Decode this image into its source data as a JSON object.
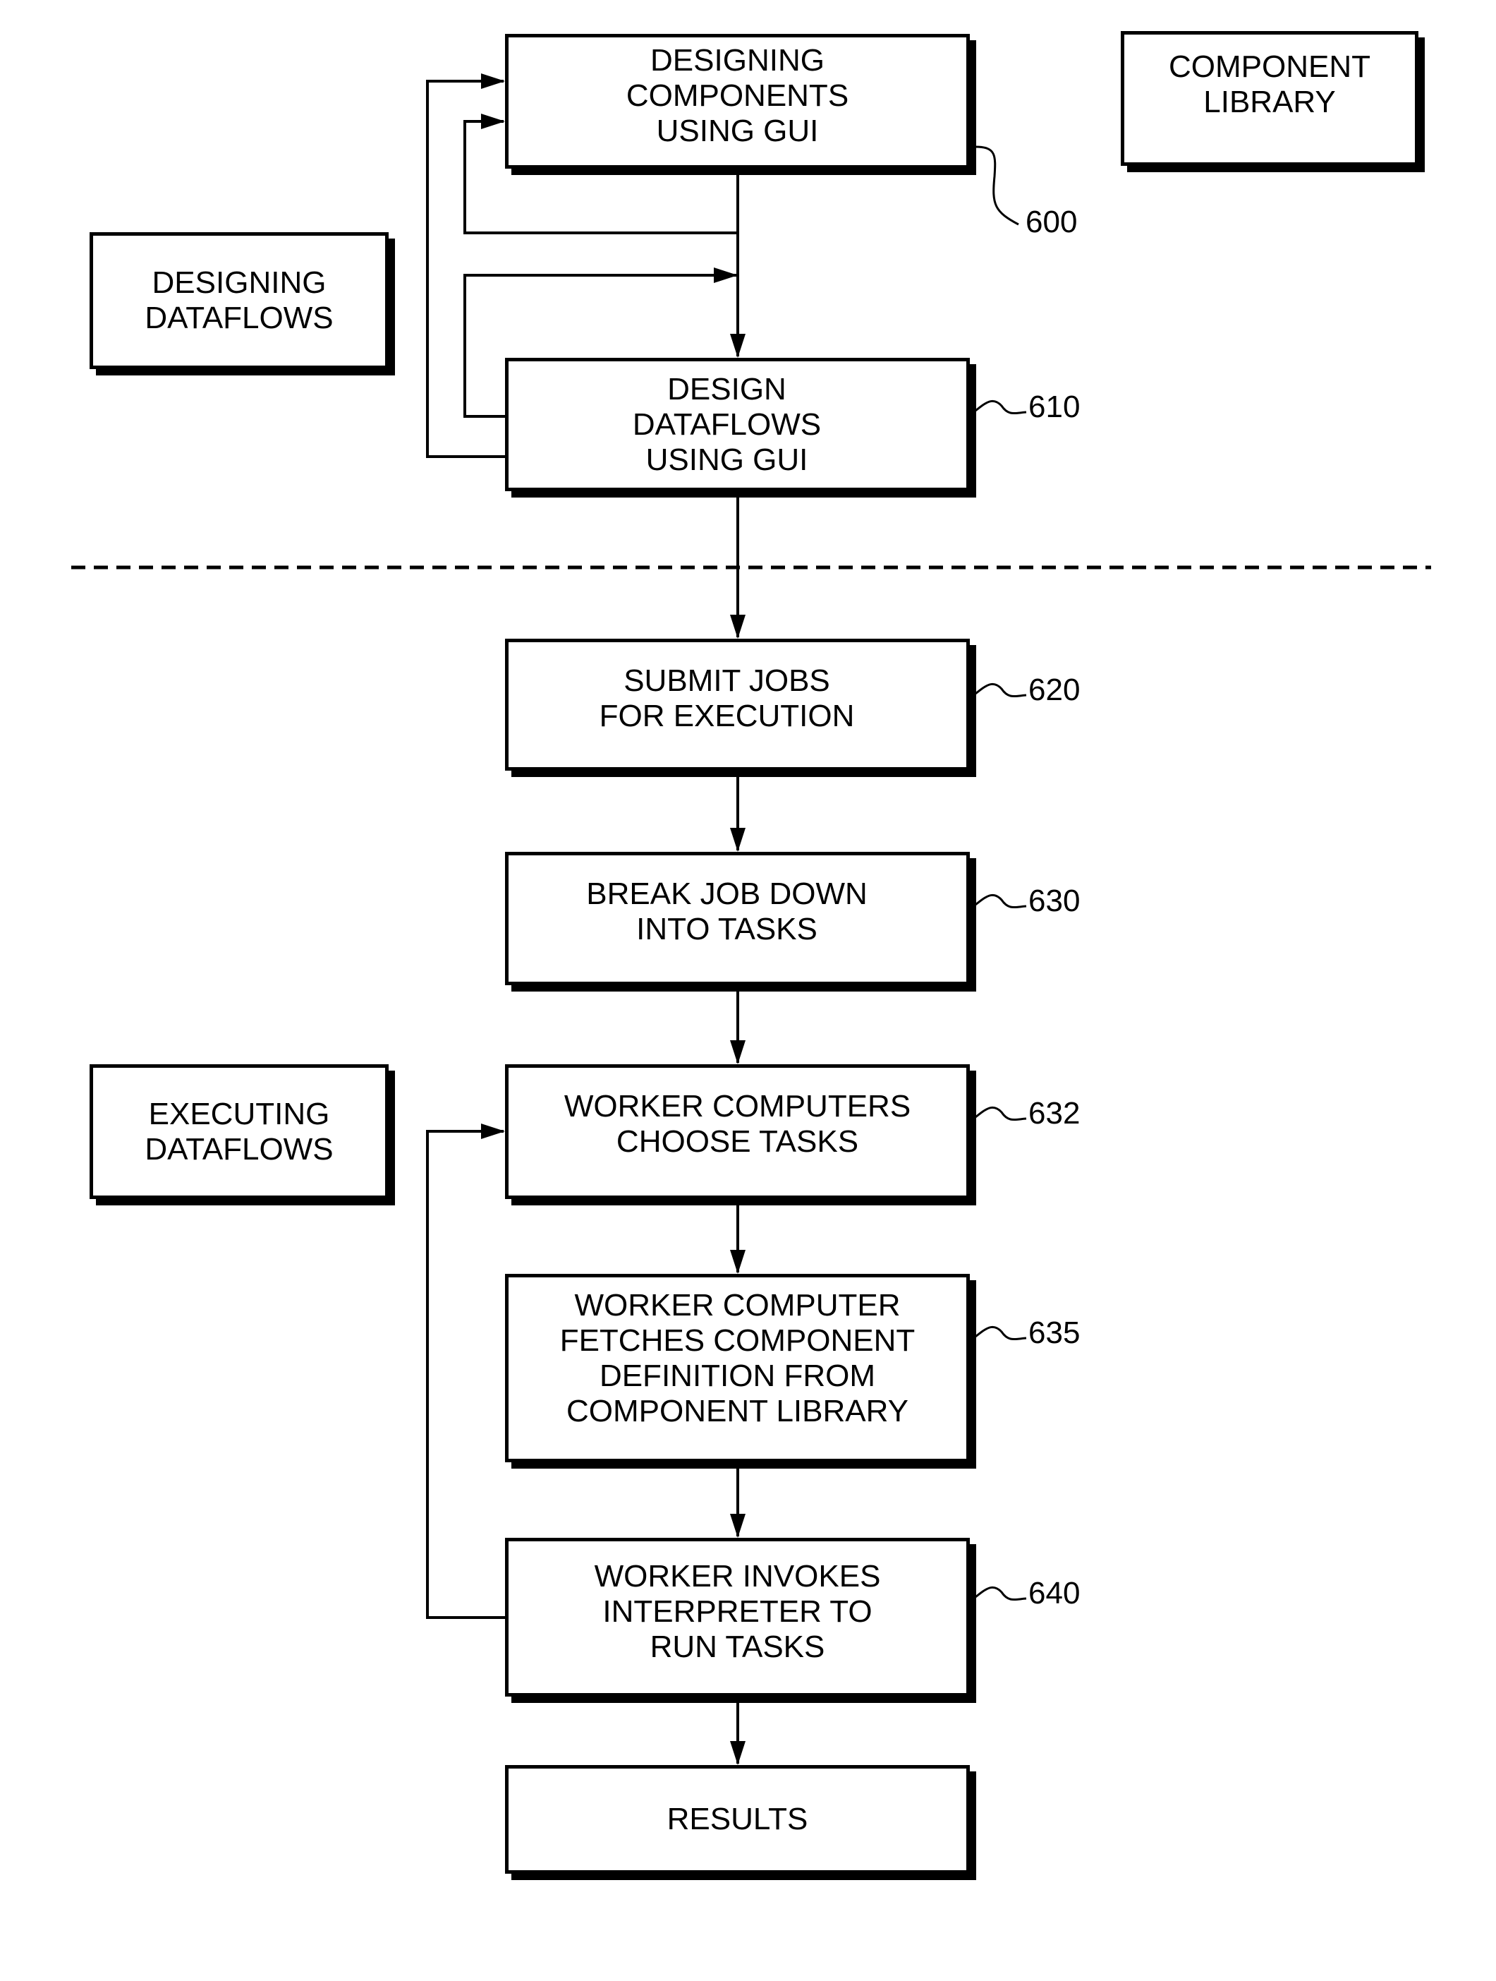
{
  "figure": {
    "sections": [
      {
        "id": "designing",
        "label": [
          "DESIGNING",
          "DATAFLOWS"
        ]
      },
      {
        "id": "executing",
        "label": [
          "EXECUTING",
          "DATAFLOWS"
        ]
      }
    ],
    "component_library": {
      "label": [
        "COMPONENT",
        "LIBRARY"
      ]
    },
    "steps": [
      {
        "ref": "600",
        "lines": [
          "DESIGNING",
          "COMPONENTS",
          "USING GUI"
        ]
      },
      {
        "ref": "610",
        "lines": [
          "DESIGN",
          "DATAFLOWS",
          "USING GUI"
        ]
      },
      {
        "ref": "620",
        "lines": [
          "SUBMIT JOBS",
          "FOR EXECUTION"
        ]
      },
      {
        "ref": "630",
        "lines": [
          "BREAK JOB DOWN",
          "INTO TASKS"
        ]
      },
      {
        "ref": "632",
        "lines": [
          "WORKER COMPUTERS",
          "CHOOSE TASKS"
        ]
      },
      {
        "ref": "635",
        "lines": [
          "WORKER COMPUTER",
          "FETCHES COMPONENT",
          "DEFINITION FROM",
          "COMPONENT LIBRARY"
        ]
      },
      {
        "ref": "640",
        "lines": [
          "WORKER INVOKES",
          "INTERPRETER TO",
          "RUN TASKS"
        ]
      },
      {
        "ref": "",
        "lines": [
          "RESULTS"
        ]
      }
    ]
  }
}
